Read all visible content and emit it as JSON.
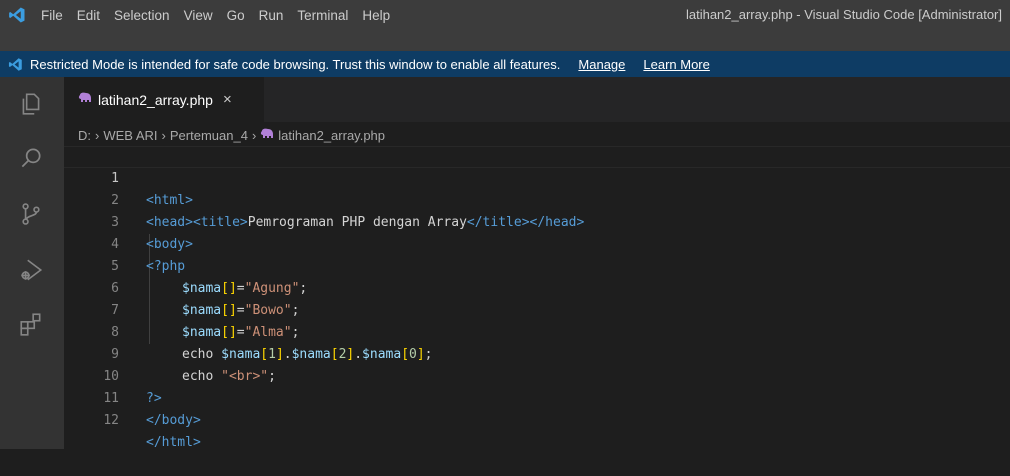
{
  "menu": [
    "File",
    "Edit",
    "Selection",
    "View",
    "Go",
    "Run",
    "Terminal",
    "Help"
  ],
  "window_title": "latihan2_array.php - Visual Studio Code [Administrator]",
  "restricted": {
    "message": "Restricted Mode is intended for safe code browsing. Trust this window to enable all features.",
    "manage": "Manage",
    "learn_more": "Learn More"
  },
  "tab": {
    "label": "latihan2_array.php",
    "close": "×"
  },
  "breadcrumb": [
    "D:",
    "WEB ARI",
    "Pertemuan_4",
    "latihan2_array.php"
  ],
  "lines": [
    {
      "num": "1"
    },
    {
      "num": "2"
    },
    {
      "num": "3"
    },
    {
      "num": "4"
    },
    {
      "num": "5"
    },
    {
      "num": "6"
    },
    {
      "num": "7"
    },
    {
      "num": "8"
    },
    {
      "num": "9"
    },
    {
      "num": "10"
    },
    {
      "num": "11"
    },
    {
      "num": "12"
    }
  ],
  "code": {
    "l1": "<html>",
    "l2a": "<head><title>",
    "l2b": "Pemrograman PHP dengan Array",
    "l2c": "</title></head>",
    "l3": "<body>",
    "l4": "<?php",
    "l5a": "$nama",
    "l5b": "[]",
    "l5c": "=",
    "l5d": "\"Agung\"",
    "l5e": ";",
    "l6d": "\"Bowo\"",
    "l7d": "\"Alma\"",
    "echo": "echo ",
    "idx1": "1",
    "idx2": "2",
    "idx0": "0",
    "l9s": "\"<br>\"",
    "l10": "?>",
    "l11": "</body>",
    "l12": "</html>"
  },
  "colors": {
    "titlebar": "#3c3c3c",
    "restricted_bar": "#0e3c64",
    "activity_bar": "#333333",
    "editor_bg": "#1e1e1e"
  },
  "icons": [
    "vscode-logo-icon",
    "explorer-icon",
    "search-icon",
    "source-control-icon",
    "run-debug-icon",
    "extensions-icon",
    "php-elephant-icon"
  ]
}
